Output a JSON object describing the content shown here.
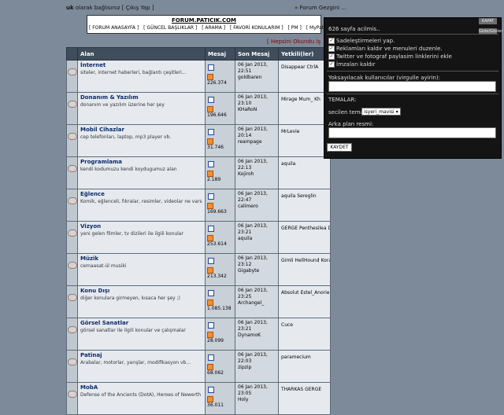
{
  "topbar": {
    "user": "uk",
    "logged_in_as": "olarak bağlısınız",
    "logout": "[ Çıkış Yap ]",
    "breadcrumb": "» Forum Gezgini ..."
  },
  "header": {
    "title": "FORUM.PATICIK.COM",
    "nav": [
      "[ FORUM ANASAYFA ]",
      "[ GÜNCEL BAŞLIKLAR ]",
      "[ ARAMA ]",
      "[ FAVORİ KONULARIM ]",
      "[ PM ]",
      "[ MyPati ]"
    ]
  },
  "mark_all": "[ Hepsini Okundu İş",
  "table": {
    "headers": {
      "alan": "Alan",
      "mesaj": "Mesaj",
      "son": "Son Mesaj",
      "yetkili": "Yetkili(ler)"
    },
    "rows": [
      {
        "name": "İnternet",
        "desc": "siteler, internet haberleri, bağlantı çeşitleri...",
        "count": "226.374",
        "date": "06 Jan 2013,",
        "time": "22:51",
        "user": "goldbaren",
        "mods": "Disappear CtrlA"
      },
      {
        "name": "Donanım & Yazılım",
        "desc": "donanım ve yazılım üzerine her şey",
        "count": "196.646",
        "date": "06 Jan 2013,",
        "time": "23:10",
        "user": "KHaRoN",
        "mods": "Mirage Mum_ Kh"
      },
      {
        "name": "Mobil Cihazlar",
        "desc": "cep telefonları, laptop, mp3 player vb.",
        "count": "31.746",
        "date": "06 Jan 2013,",
        "time": "20:14",
        "user": "reampage",
        "mods": "MrLevie"
      },
      {
        "name": "Programlama",
        "desc": "kendi kodumuzu kendi koydugumuz alan",
        "count": "2.189",
        "date": "06 Jan 2013,",
        "time": "22:13",
        "user": "Kojiroh",
        "mods": "aquila"
      },
      {
        "name": "Eğlence",
        "desc": "Komik, eğlenceli, fıkralar, resimler, videolar ne varsa...",
        "count": "169.663",
        "date": "06 Jan 2013,",
        "time": "22:47",
        "user": "calimero",
        "mods": "aquila Sereglin"
      },
      {
        "name": "Vizyon",
        "desc": "yeni gelen filmler, tv dizileri ile ilgili konular",
        "count": "253.614",
        "date": "06 Jan 2013,",
        "time": "23:21",
        "user": "aquila",
        "mods": "GERGE Penthesilea DarKRidaR"
      },
      {
        "name": "Müzik",
        "desc": "cemaasat-ül musiki",
        "count": "213.342",
        "date": "06 Jan 2013,",
        "time": "23:12",
        "user": "Gigabyte",
        "mods": "Gimli HellHound Koray"
      },
      {
        "name": "Konu Dışı",
        "desc": "diğer konulara girmeyen, kısaca her şey ;)",
        "count": "1.085.138",
        "date": "06 Jan 2013,",
        "time": "23:25",
        "user": "Archangel_",
        "mods": "Absolut Estel_Anorien dasaaa"
      },
      {
        "name": "Görsel Sanatlar",
        "desc": "görsel sanatlar ile ilgili konular ve çalışmalar",
        "count": "28.099",
        "date": "06 Jan 2013,",
        "time": "23:21",
        "user": "DynamoK",
        "mods": "Cuce"
      },
      {
        "name": "Patinaj",
        "desc": "Arabalar, motorlar, yarışlar, modifikasyon vb...",
        "count": "68.062",
        "date": "06 Jan 2013,",
        "time": "22:03",
        "user": "zipzip",
        "mods": "paramecium"
      },
      {
        "name": "MobA",
        "desc": "Defense of the Ancients (DotA), Heroes of Newerth (HoN) ve benzer oyunlar",
        "count": "36.011",
        "date": "06 Jan 2013,",
        "time": "23:05",
        "user": "Holy",
        "mods": "THARKAS GERGE"
      }
    ]
  },
  "panel": {
    "count_text": "626 sayfa acilmis..",
    "btn1": "KAPAT",
    "btn2": "Gizle/Göster",
    "options": [
      {
        "label": "Sadeleştirmeleri yap.",
        "checked": "✓"
      },
      {
        "label": "Reklamları kaldır ve menuleri duzenle.",
        "checked": "✓"
      },
      {
        "label": "Twitter ve fotograf paylasim linklerini ekle",
        "checked": "✓"
      },
      {
        "label": "İmzaları kaldır",
        "checked": "✓"
      }
    ],
    "hidden_users_label": "Yoksayılacak kullanıcılar (virgulle ayirin):",
    "themes_label": "TEMALAR:",
    "theme_select_label": "secilen tema:",
    "theme_value": "isyeri_mavisi",
    "bg_label": "Arka plan resmi:",
    "save": "KAYDET"
  }
}
